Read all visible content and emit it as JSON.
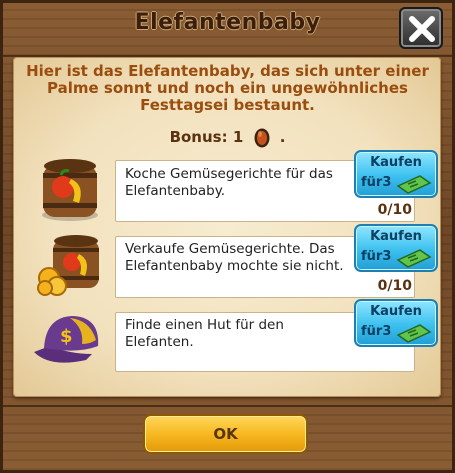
{
  "dialog": {
    "title": "Elefantenbaby",
    "description": "Hier ist das Elefantenbaby, das sich unter einer Palme sonnt und noch ein ungewöhnliches Festtagsei bestaunt.",
    "bonus_label": "Bonus:",
    "bonus_value": "1",
    "bonus_suffix": ".",
    "bonus_icon": "egg-icon"
  },
  "tasks": [
    {
      "text": "Koche Gemüsegerichte für das Elefantenbaby.",
      "icon": "vegetable-barrel-icon",
      "progress": "0/10",
      "buy_label": "Kaufen",
      "buy_cost_prefix": "für",
      "buy_cost": "3",
      "currency_icon": "cash-icon"
    },
    {
      "text": "Verkaufe Gemüsegerichte. Das Elefantenbaby mochte sie nicht.",
      "icon": "vegetable-barrel-coins-icon",
      "progress": "0/10",
      "buy_label": "Kaufen",
      "buy_cost_prefix": "für",
      "buy_cost": "3",
      "currency_icon": "cash-icon"
    },
    {
      "text": "Finde einen Hut für den Elefanten.",
      "icon": "cap-icon",
      "progress": "",
      "buy_label": "Kaufen",
      "buy_cost_prefix": "für",
      "buy_cost": "3",
      "currency_icon": "cash-icon"
    }
  ],
  "ok_label": "OK",
  "colors": {
    "wood": "#7a5230",
    "parchment": "#f2e1bd",
    "title": "#3b1f0c",
    "description": "#9a4d0e",
    "buy_button": "#3cc0ef",
    "ok_button": "#f6b51d"
  }
}
